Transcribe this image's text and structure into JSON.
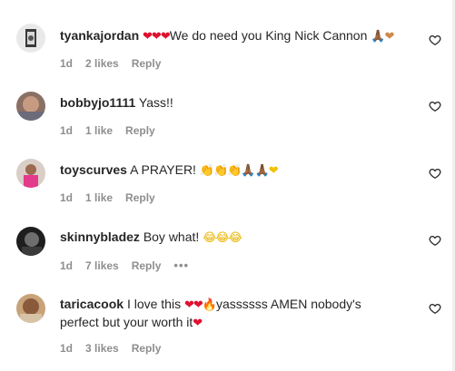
{
  "comments": [
    {
      "username": "tyankajordan",
      "emoji_prefix": "❤❤❤",
      "text": "We do need you King Nick Cannon",
      "emoji_suffix": "🙏🏾❤",
      "time": "1d",
      "likes": "2 likes",
      "reply": "Reply"
    },
    {
      "username": "bobbyjo1111",
      "text": "Yass!!",
      "time": "1d",
      "likes": "1 like",
      "reply": "Reply"
    },
    {
      "username": "toyscurves",
      "text": "A PRAYER!",
      "emoji_suffix": "👏👏👏🙏🏾🙏🏾❤",
      "time": "1d",
      "likes": "1 like",
      "reply": "Reply"
    },
    {
      "username": "skinnybladez",
      "text": "Boy what!",
      "emoji_suffix": "😂😂😂",
      "time": "1d",
      "likes": "7 likes",
      "reply": "Reply",
      "more": "•••"
    },
    {
      "username": "taricacook",
      "text_a": "I love this",
      "emoji_mid": "❤❤🔥",
      "text_b": "yassssss AMEN nobody's",
      "text_c": "perfect but your worth it",
      "emoji_suffix": "❤",
      "time": "1d",
      "likes": "3 likes",
      "reply": "Reply"
    }
  ],
  "icons": {
    "like": "heart-outline-icon",
    "more": "more-horizontal-icon"
  },
  "colors": {
    "text": "#262626",
    "meta": "#8e8e8e",
    "heart": "#e0102e"
  }
}
